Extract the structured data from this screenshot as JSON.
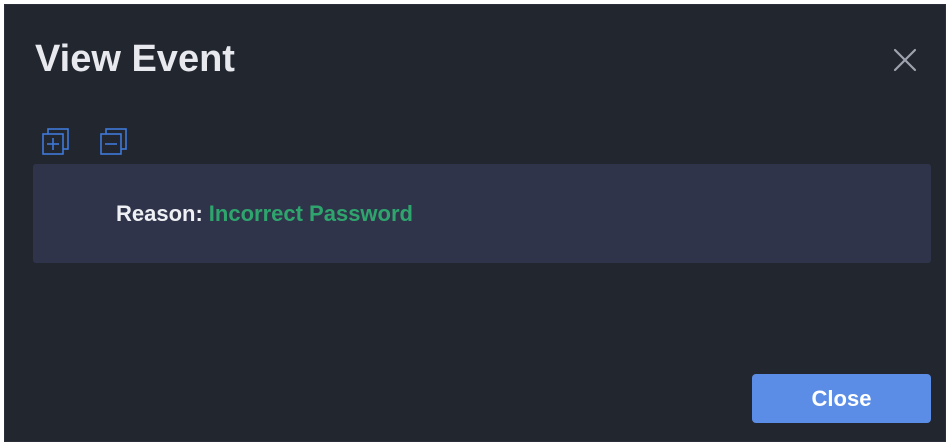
{
  "dialog": {
    "title": "View Event",
    "close_icon": "close-icon"
  },
  "toolbar": {
    "expand_icon": "expand-all-icon",
    "collapse_icon": "collapse-all-icon"
  },
  "details": {
    "reason_label": "Reason:",
    "reason_value": "Incorrect Password"
  },
  "footer": {
    "close_label": "Close"
  },
  "colors": {
    "background": "#22262f",
    "panel": "#30344a",
    "accent": "#5b8de6",
    "success": "#2fa56e",
    "icon_blue": "#3f78d9"
  }
}
